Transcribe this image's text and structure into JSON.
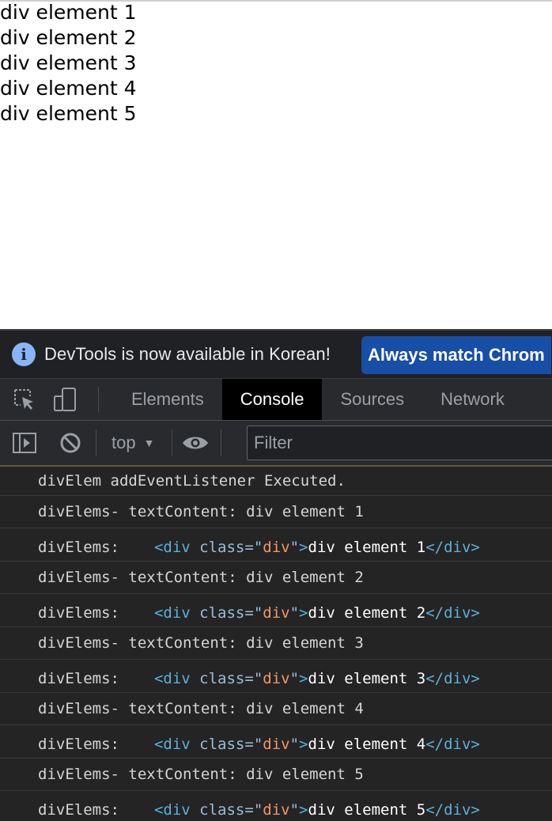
{
  "page": {
    "divs": [
      "div element 1",
      "div element 2",
      "div element 3",
      "div element 4",
      "div element 5"
    ]
  },
  "infobar": {
    "message": "DevTools is now available in Korean!",
    "button": "Always match Chrom",
    "icon": "info-icon"
  },
  "tabs": [
    {
      "label": "Elements",
      "active": false
    },
    {
      "label": "Console",
      "active": true
    },
    {
      "label": "Sources",
      "active": false
    },
    {
      "label": "Network",
      "active": false
    }
  ],
  "toolbar": {
    "context": "top",
    "filter_placeholder": "Filter"
  },
  "console": {
    "first": "divElem addEventListener Executed.",
    "entries": [
      {
        "text_line": "divElems- textContent: div element 1",
        "elem_label": "divElems:",
        "open_tag": "<div",
        "attr": "class=",
        "attr_q1": "\"",
        "attr_val": "div",
        "attr_q2": "\"",
        "gt": ">",
        "inner": "div element 1",
        "close_tag": "</div>"
      },
      {
        "text_line": "divElems- textContent: div element 2",
        "elem_label": "divElems:",
        "open_tag": "<div",
        "attr": "class=",
        "attr_q1": "\"",
        "attr_val": "div",
        "attr_q2": "\"",
        "gt": ">",
        "inner": "div element 2",
        "close_tag": "</div>"
      },
      {
        "text_line": "divElems- textContent: div element 3",
        "elem_label": "divElems:",
        "open_tag": "<div",
        "attr": "class=",
        "attr_q1": "\"",
        "attr_val": "div",
        "attr_q2": "\"",
        "gt": ">",
        "inner": "div element 3",
        "close_tag": "</div>"
      },
      {
        "text_line": "divElems- textContent: div element 4",
        "elem_label": "divElems:",
        "open_tag": "<div",
        "attr": "class=",
        "attr_q1": "\"",
        "attr_val": "div",
        "attr_q2": "\"",
        "gt": ">",
        "inner": "div element 4",
        "close_tag": "</div>"
      },
      {
        "text_line": "divElems- textContent: div element 5",
        "elem_label": "divElems:",
        "open_tag": "<div",
        "attr": "class=",
        "attr_q1": "\"",
        "attr_val": "div",
        "attr_q2": "\"",
        "gt": ">",
        "inner": "div element 5",
        "close_tag": "</div>"
      }
    ]
  },
  "colors": {
    "devtools_bg": "#242424",
    "tag": "#5db0d7",
    "attr_value": "#f29766",
    "button_blue": "#174ea6"
  }
}
